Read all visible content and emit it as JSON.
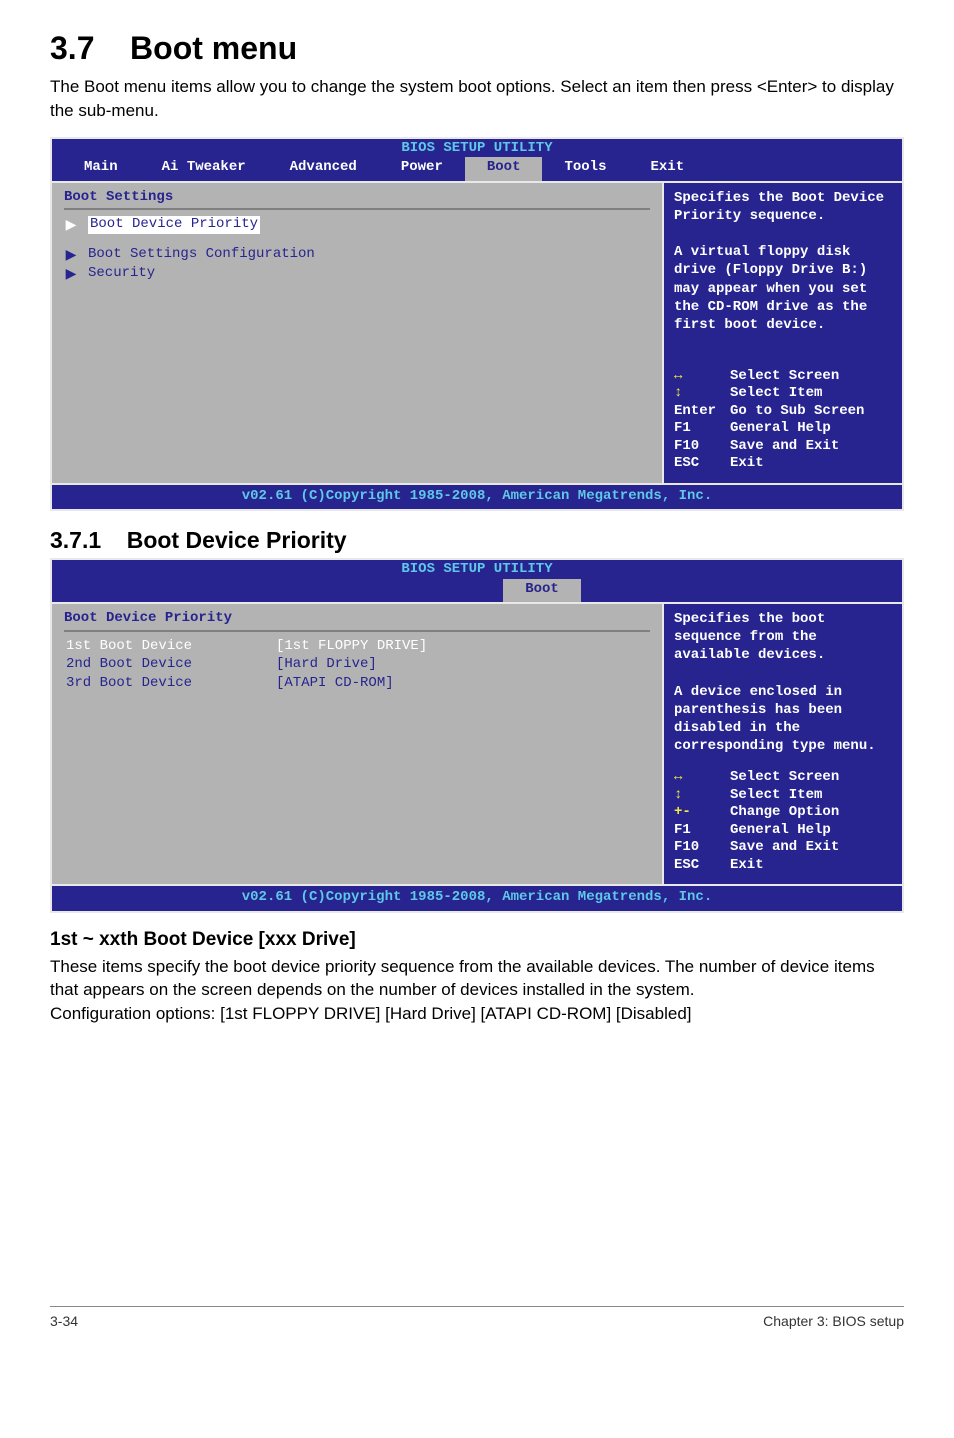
{
  "section": {
    "number_title": "3.7",
    "title": "Boot menu",
    "intro": "The Boot menu items allow you to change the system boot options. Select an item then press <Enter> to display the sub-menu."
  },
  "bios1": {
    "title": "BIOS SETUP UTILITY",
    "tabs": [
      "Main",
      "Ai Tweaker",
      "Advanced",
      "Power",
      "Boot",
      "Tools",
      "Exit"
    ],
    "selected_tab": "Boot",
    "left": {
      "heading": "Boot Settings",
      "items": [
        {
          "label": "Boot Device Priority",
          "highlighted": true
        },
        {
          "label": "Boot Settings Configuration",
          "highlighted": false
        },
        {
          "label": "Security",
          "highlighted": false
        }
      ]
    },
    "right": {
      "help": "Specifies the Boot Device Priority sequence.\n\nA virtual floppy disk drive (Floppy Drive B:) may appear when you set the CD-ROM drive as the first boot device.",
      "nav": [
        {
          "key": "↔",
          "keyClass": "yellow",
          "label": "Select Screen"
        },
        {
          "key": "↕",
          "keyClass": "yellow",
          "label": "Select Item"
        },
        {
          "key": "Enter",
          "label": "Go to Sub Screen",
          "full": true
        },
        {
          "key": "F1",
          "label": "General Help"
        },
        {
          "key": "F10",
          "label": "Save and Exit"
        },
        {
          "key": "ESC",
          "label": "Exit"
        }
      ]
    },
    "footer": "v02.61 (C)Copyright 1985-2008, American Megatrends, Inc."
  },
  "subsection": {
    "number": "3.7.1",
    "title": "Boot Device Priority"
  },
  "bios2": {
    "title": "BIOS SETUP UTILITY",
    "selected_tab": "Boot",
    "left": {
      "heading": "Boot Device Priority",
      "rows": [
        {
          "c1": "1st Boot Device",
          "c2": "[1st FLOPPY DRIVE]",
          "highlighted": true
        },
        {
          "c1": "2nd Boot Device",
          "c2": "[Hard Drive]",
          "highlighted": false
        },
        {
          "c1": "3rd Boot Device",
          "c2": "[ATAPI CD-ROM]",
          "highlighted": false
        }
      ]
    },
    "right": {
      "help": "Specifies the boot sequence from the available devices.\n\nA device enclosed in parenthesis has been disabled in the corresponding type menu.",
      "nav": [
        {
          "key": "↔",
          "keyClass": "yellow",
          "label": "Select Screen"
        },
        {
          "key": "↕",
          "keyClass": "yellow",
          "label": "Select Item"
        },
        {
          "key": "+-",
          "keyClass": "yellow",
          "label": "Change Option"
        },
        {
          "key": "F1",
          "label": "General Help"
        },
        {
          "key": "F10",
          "label": "Save and Exit"
        },
        {
          "key": "ESC",
          "label": "Exit"
        }
      ]
    },
    "footer": "v02.61 (C)Copyright 1985-2008, American Megatrends, Inc."
  },
  "sub3": {
    "title": "1st ~ xxth Boot Device [xxx Drive]",
    "para1": "These items specify the boot device priority sequence from the available devices. The number of device items that appears on the screen depends on the number of devices installed in the system.",
    "para2": "Configuration options: [1st FLOPPY DRIVE] [Hard Drive] [ATAPI CD-ROM] [Disabled]"
  },
  "footer": {
    "left": "3-34",
    "right": "Chapter 3: BIOS setup"
  }
}
